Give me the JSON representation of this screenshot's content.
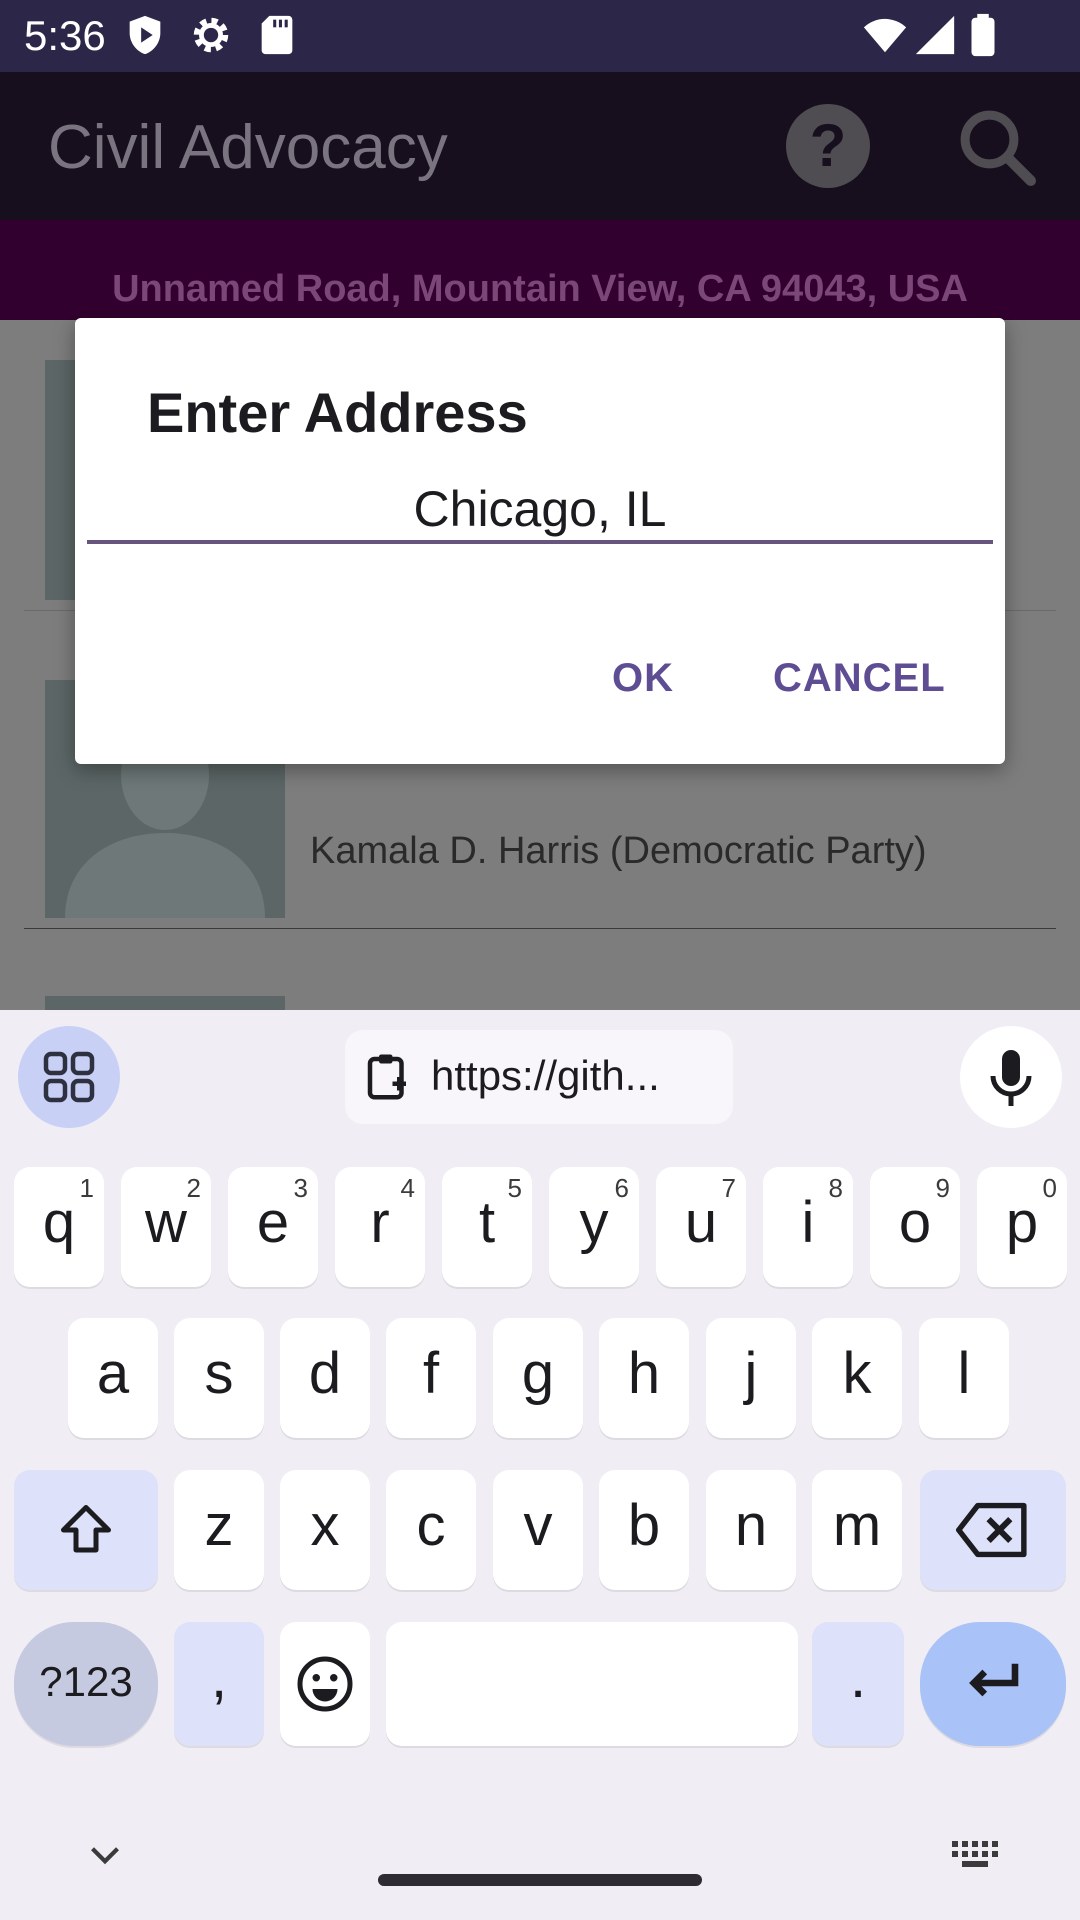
{
  "status_bar": {
    "time": "5:36"
  },
  "app_bar": {
    "title": "Civil Advocacy"
  },
  "location": {
    "address": "Unnamed Road, Mountain View, CA 94043, USA"
  },
  "list": {
    "item_name": "Kamala D. Harris (Democratic Party)"
  },
  "dialog": {
    "title": "Enter Address",
    "input_value": "Chicago, IL",
    "ok_label": "OK",
    "cancel_label": "CANCEL"
  },
  "keyboard": {
    "clipboard_text": "https://gith...",
    "row1": [
      {
        "ch": "q",
        "sup": "1"
      },
      {
        "ch": "w",
        "sup": "2"
      },
      {
        "ch": "e",
        "sup": "3"
      },
      {
        "ch": "r",
        "sup": "4"
      },
      {
        "ch": "t",
        "sup": "5"
      },
      {
        "ch": "y",
        "sup": "6"
      },
      {
        "ch": "u",
        "sup": "7"
      },
      {
        "ch": "i",
        "sup": "8"
      },
      {
        "ch": "o",
        "sup": "9"
      },
      {
        "ch": "p",
        "sup": "0"
      }
    ],
    "row2": [
      "a",
      "s",
      "d",
      "f",
      "g",
      "h",
      "j",
      "k",
      "l"
    ],
    "row3": [
      "z",
      "x",
      "c",
      "v",
      "b",
      "n",
      "m"
    ],
    "symbols_label": "?123",
    "comma_label": ",",
    "period_label": "."
  },
  "colors": {
    "accent": "#5f4d94",
    "status_bar": "#2c2749",
    "address_bar": "#32002f"
  },
  "icons": [
    "shield-icon",
    "gear-icon",
    "sd-card-icon",
    "wifi-icon",
    "signal-icon",
    "battery-icon",
    "help-icon",
    "search-icon",
    "grid-icon",
    "clipboard-icon",
    "mic-icon",
    "shift-icon",
    "backspace-icon",
    "emoji-icon",
    "enter-icon",
    "chevron-down-icon",
    "keyboard-icon"
  ]
}
